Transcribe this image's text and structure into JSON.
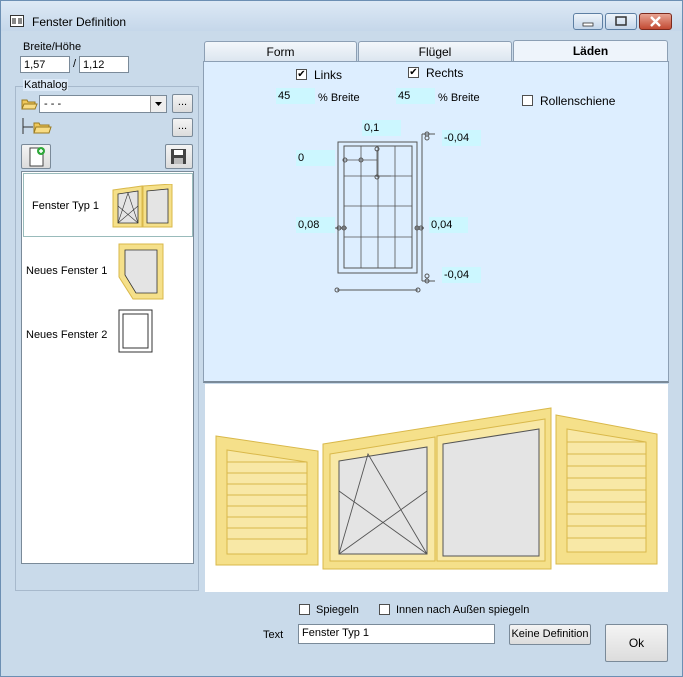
{
  "window": {
    "title": "Fenster Definition"
  },
  "size": {
    "label": "Breite/Höhe",
    "width": "1,57",
    "separator": "/",
    "height": "1,12"
  },
  "catalog": {
    "label": "Kathalog",
    "folder_value": "- - -",
    "browse_label": "...",
    "items": [
      {
        "name": "Fenster Typ 1"
      },
      {
        "name": "Neues Fenster 1"
      },
      {
        "name": "Neues Fenster 2"
      }
    ]
  },
  "tabs": [
    {
      "label": "Form"
    },
    {
      "label": "Flügel"
    },
    {
      "label": "Läden"
    }
  ],
  "shutters": {
    "left": {
      "label": "Links",
      "checked": true,
      "percent": "45",
      "percent_label": "% Breite"
    },
    "right": {
      "label": "Rechts",
      "checked": true,
      "percent": "45",
      "percent_label": "% Breite"
    },
    "rail": {
      "label": "Rollenschiene",
      "checked": false
    },
    "values": {
      "top": "0,1",
      "left_top": "0",
      "left_mid": "0,08",
      "right_mid": "0,04",
      "right_top": "-0,04",
      "right_bottom": "-0,04"
    }
  },
  "options": {
    "mirror_label": "Spiegeln",
    "inside_out_label": "Innen nach Außen spiegeln"
  },
  "text": {
    "label": "Text",
    "value": "Fenster Typ 1"
  },
  "buttons": {
    "no_definition": "Keine Definition",
    "ok": "Ok"
  },
  "colors": {
    "frame_fill": "#f5e08a",
    "frame_stroke": "#d9b84a",
    "glass": "#e4e4e4",
    "panel_bg": "#ddeeff",
    "value_bg": "#ccf7ff"
  }
}
